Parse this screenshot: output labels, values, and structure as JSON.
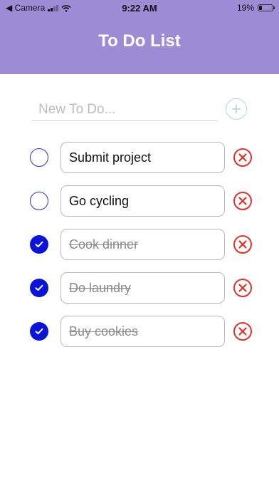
{
  "status_bar": {
    "back_label": "◀ Camera",
    "time": "9:22 AM",
    "battery": "19%",
    "battery_level": 0.19
  },
  "header": {
    "title": "To Do List"
  },
  "new_todo": {
    "placeholder": "New To Do...",
    "value": ""
  },
  "colors": {
    "header_bg": "#9d8bd6",
    "check_done": "#0a14d8",
    "check_border": "#2b33c9",
    "delete_red": "#e0312b",
    "add_button": "#a9d7ef"
  },
  "todos": [
    {
      "text": "Submit project",
      "done": false
    },
    {
      "text": "Go cycling",
      "done": false
    },
    {
      "text": "Cook dinner",
      "done": true
    },
    {
      "text": "Do laundry",
      "done": true
    },
    {
      "text": "Buy cookies",
      "done": true
    }
  ]
}
